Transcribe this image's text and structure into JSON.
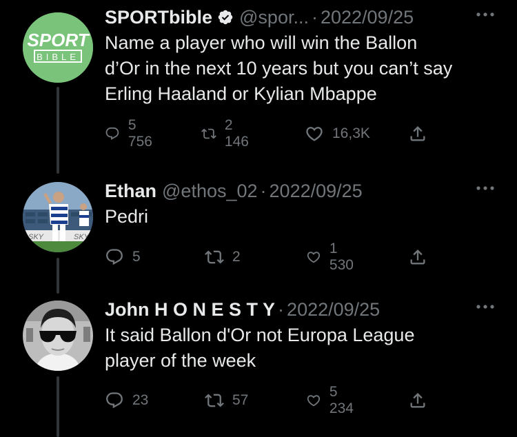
{
  "tweets": [
    {
      "name": "SPORTbible",
      "verified": true,
      "handle": "@spor...",
      "separator": "·",
      "date": "2022/09/25",
      "text_lines": [
        "Name a player who will win the Ballon",
        "d’Or in the next 10 years but you can’t say",
        "Erling Haaland or Kylian Mbappe"
      ],
      "avatar": {
        "logo_top": "SPORT",
        "logo_bottom": "BIBLE",
        "bg": "#7ac37b"
      },
      "replies": "5 756",
      "retweets": "2 146",
      "likes": "16,3K"
    },
    {
      "name": "Ethan",
      "verified": false,
      "handle": "@ethos_02",
      "separator": "·",
      "date": "2022/09/25",
      "text_lines": [
        "Pedri"
      ],
      "avatar": {
        "billboard_left": "SKY",
        "billboard_right": "SKY"
      },
      "replies": "5",
      "retweets": "2",
      "likes": "1 530"
    },
    {
      "name": "John H O N E S T Y",
      "verified": false,
      "handle": "",
      "separator": "·",
      "date": "2022/09/25",
      "text_lines": [
        "It said Ballon d'Or not Europa League",
        "player of the week"
      ],
      "avatar": {},
      "replies": "23",
      "retweets": "57",
      "likes": "5 234"
    }
  ],
  "colors": {
    "background": "#000000",
    "text": "#e7e9ea",
    "muted": "#71767b",
    "verified": "#e7e9ea"
  }
}
